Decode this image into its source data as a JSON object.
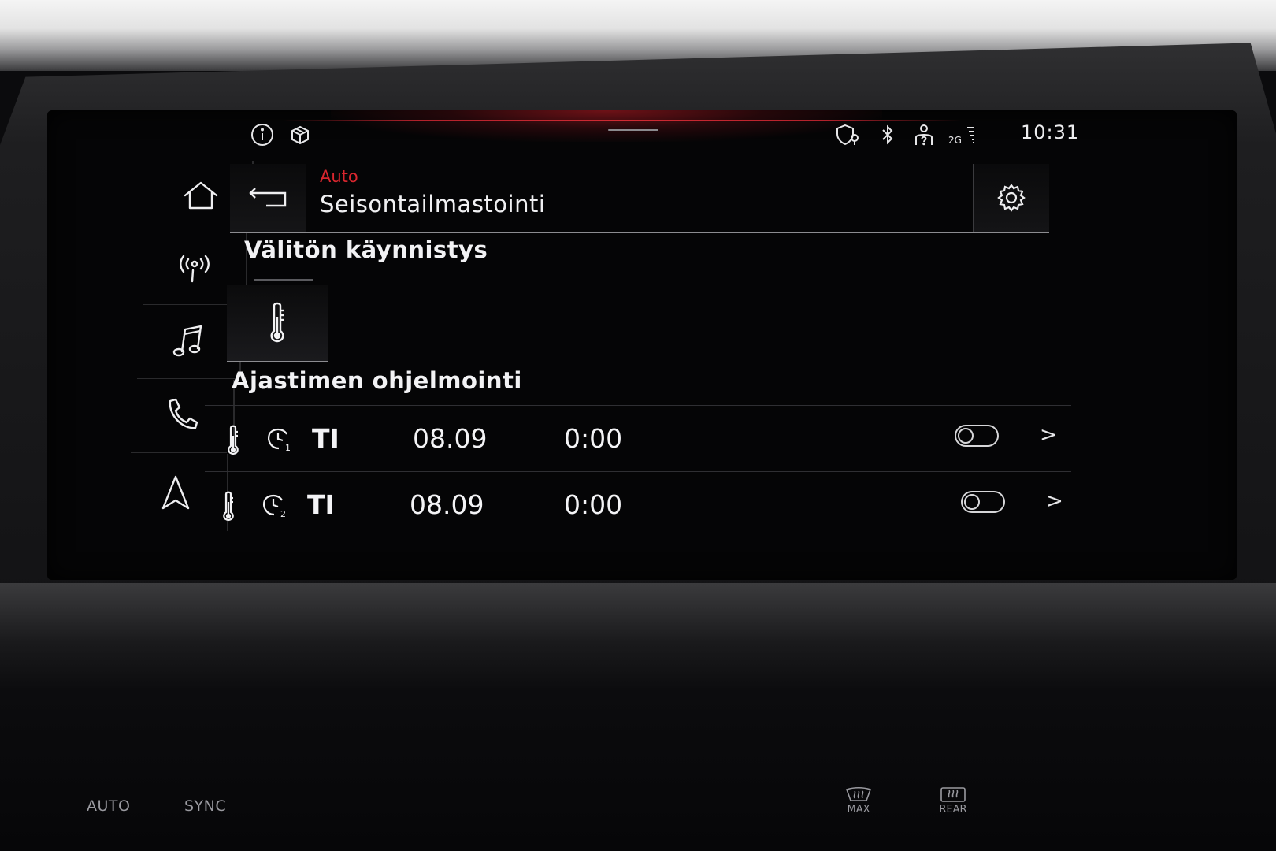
{
  "status_bar": {
    "time": "10:31",
    "network_label": "2G",
    "icons": [
      "info-icon",
      "box-icon",
      "privacy-location-icon",
      "bluetooth-icon",
      "user-help-icon",
      "signal-icon"
    ]
  },
  "sidebar": {
    "items": [
      {
        "name": "home",
        "icon": "home-icon"
      },
      {
        "name": "radio",
        "icon": "radio-antenna-icon"
      },
      {
        "name": "media",
        "icon": "music-note-icon"
      },
      {
        "name": "phone",
        "icon": "phone-icon"
      },
      {
        "name": "navigation",
        "icon": "navigation-arrow-icon"
      }
    ]
  },
  "header": {
    "breadcrumb": "Auto",
    "title": "Seisontailmastointi",
    "back_icon": "back-arrow-icon",
    "settings_icon": "gear-icon"
  },
  "immediate_start": {
    "title": "Välitön käynnistys",
    "tile_icon": "thermometer-icon"
  },
  "timers": {
    "title": "Ajastimen ohjelmointi",
    "rows": [
      {
        "timer_no": "1",
        "day": "TI",
        "date": "08.09",
        "time": "0:00",
        "enabled": false
      },
      {
        "timer_no": "2",
        "day": "TI",
        "date": "08.09",
        "time": "0:00",
        "enabled": false
      }
    ]
  },
  "hardware_buttons": {
    "auto": "AUTO",
    "sync": "SYNC",
    "max": "MAX",
    "rear": "REAR"
  },
  "colors": {
    "accent_red": "#d9262e",
    "text": "#f0f0f2",
    "background": "#050506"
  }
}
